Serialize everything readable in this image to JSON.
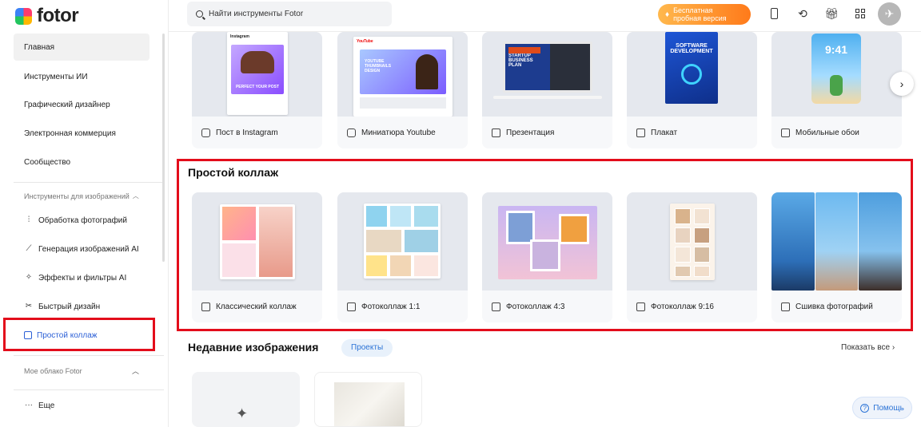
{
  "app": {
    "logo_text": "fotor"
  },
  "sidebar": {
    "main_items": [
      {
        "label": "Главная"
      },
      {
        "label": "Инструменты ИИ"
      },
      {
        "label": "Графический дизайнер"
      },
      {
        "label": "Электронная коммерция"
      },
      {
        "label": "Сообщество"
      }
    ],
    "image_tools_header": "Инструменты для изображений",
    "tools": [
      {
        "label": "Обработка фотографий",
        "icon": "sliders-icon"
      },
      {
        "label": "Генерация изображений AI",
        "icon": "magic-wand-icon"
      },
      {
        "label": "Эффекты и фильтры AI",
        "icon": "sparkle-icon"
      },
      {
        "label": "Быстрый дизайн",
        "icon": "design-tools-icon"
      },
      {
        "label": "Простой коллаж",
        "icon": "collage-icon"
      }
    ],
    "cloud_header": "Мое облако Fotor",
    "more_label": "Еще"
  },
  "header": {
    "search_placeholder": "Найти инструменты Fotor",
    "trial_line1": "Бесплатная",
    "trial_line2": "пробная версия"
  },
  "templates": [
    {
      "label": "Пост в Instagram",
      "icon": "instagram-icon"
    },
    {
      "label": "Миниатюра Youtube",
      "icon": "youtube-icon"
    },
    {
      "label": "Презентация",
      "icon": "presentation-icon"
    },
    {
      "label": "Плакат",
      "icon": "poster-icon"
    },
    {
      "label": "Мобильные обои",
      "icon": "phone-icon"
    }
  ],
  "template_thumbs": {
    "instagram_brand": "Instagram",
    "instagram_text": "PERFECT YOUR POST",
    "youtube_brand": "YouTube",
    "youtube_text": "YOUTUBE THUMBNAILS DESIGN",
    "presentation_text": "STARTUP BUSINESS PLAN",
    "poster_text": "SOFTWARE DEVELOPMENT",
    "wallpaper_time": "9:41"
  },
  "collage": {
    "title": "Простой коллаж",
    "items": [
      {
        "label": "Классический коллаж",
        "icon": "layout-icon"
      },
      {
        "label": "Фотоколлаж 1:1",
        "icon": "image-icon"
      },
      {
        "label": "Фотоколлаж 4:3",
        "icon": "image-icon"
      },
      {
        "label": "Фотоколлаж 9:16",
        "icon": "image-icon"
      },
      {
        "label": "Сшивка фотографий",
        "icon": "stitch-icon"
      }
    ]
  },
  "recent": {
    "title": "Недавние изображения",
    "tag": "Проекты",
    "show_all": "Показать все"
  },
  "help_label": "Помощь"
}
